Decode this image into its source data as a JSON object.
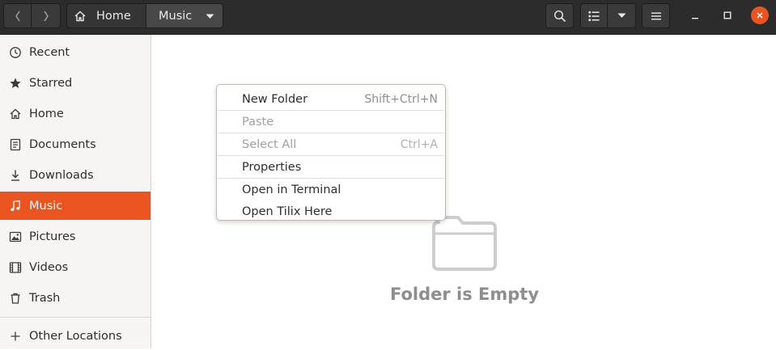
{
  "header": {
    "breadcrumb": [
      {
        "label": "Home"
      },
      {
        "label": "Music"
      }
    ]
  },
  "sidebar": {
    "items": [
      {
        "label": "Recent",
        "icon": "clock-icon"
      },
      {
        "label": "Starred",
        "icon": "star-icon"
      },
      {
        "label": "Home",
        "icon": "home-icon"
      },
      {
        "label": "Documents",
        "icon": "document-icon"
      },
      {
        "label": "Downloads",
        "icon": "download-icon"
      },
      {
        "label": "Music",
        "icon": "music-icon",
        "active": true
      },
      {
        "label": "Pictures",
        "icon": "picture-icon"
      },
      {
        "label": "Videos",
        "icon": "video-icon"
      },
      {
        "label": "Trash",
        "icon": "trash-icon"
      }
    ],
    "other_locations": {
      "label": "Other Locations",
      "icon": "plus-icon"
    }
  },
  "context_menu": {
    "items": [
      {
        "label": "New Folder",
        "shortcut": "Shift+Ctrl+N",
        "enabled": true
      },
      {
        "label": "Paste",
        "shortcut": "",
        "enabled": false
      },
      {
        "label": "Select All",
        "shortcut": "Ctrl+A",
        "enabled": false
      },
      {
        "label": "Properties",
        "shortcut": "",
        "enabled": true
      },
      {
        "label": "Open in Terminal",
        "shortcut": "",
        "enabled": true
      },
      {
        "label": "Open Tilix Here",
        "shortcut": "",
        "enabled": true
      }
    ]
  },
  "main": {
    "empty_message": "Folder is Empty"
  },
  "colors": {
    "accent": "#e95420",
    "headerbar": "#2c2c2c",
    "sidebar_bg": "#f6f5f4"
  }
}
